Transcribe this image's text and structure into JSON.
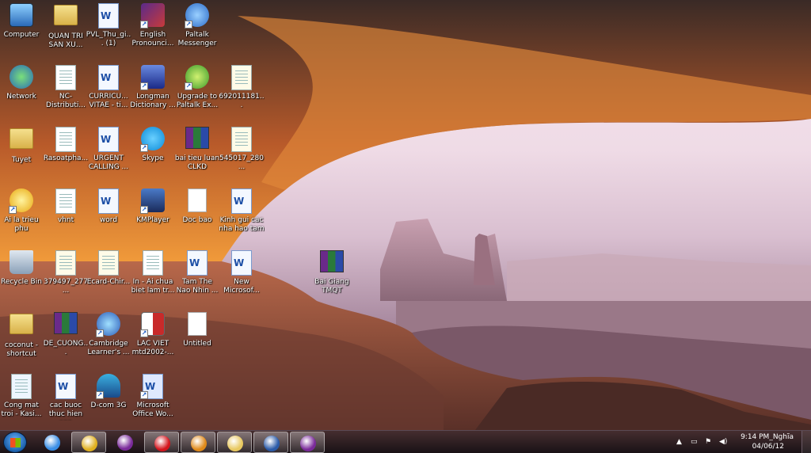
{
  "desktop": {
    "icons": [
      {
        "label": "Computer",
        "icon": "computer-icon"
      },
      {
        "label": "QUAN TRI SAN XU...",
        "icon": "folder-icon"
      },
      {
        "label": "PVL_Thu_gi... (1)",
        "icon": "word-document-icon"
      },
      {
        "label": "English Pronounci...",
        "icon": "epd-app-icon"
      },
      {
        "label": "Paltalk Messenger",
        "icon": "paltalk-icon"
      },
      {
        "label": "Network",
        "icon": "network-icon"
      },
      {
        "label": "NC-Distributi...",
        "icon": "document-icon"
      },
      {
        "label": "CURRICU... VITAE - ti...",
        "icon": "word-document-icon"
      },
      {
        "label": "Longman Dictionary ...",
        "icon": "longman-icon"
      },
      {
        "label": "Upgrade to Paltalk Ex...",
        "icon": "paltalk-upgrade-icon"
      },
      {
        "label": "692011181...",
        "icon": "image-file-icon"
      },
      {
        "label": "Tuyet",
        "icon": "folder-icon"
      },
      {
        "label": "Rasoatpha...",
        "icon": "document-icon"
      },
      {
        "label": "URGENT CALLING ...",
        "icon": "word-document-icon"
      },
      {
        "label": "Skype",
        "icon": "skype-icon"
      },
      {
        "label": "bai tieu luan CLKD",
        "icon": "winrar-archive-icon"
      },
      {
        "label": "545017_280...",
        "icon": "image-file-icon"
      },
      {
        "label": "Ai la trieu phu",
        "icon": "star-game-icon"
      },
      {
        "label": "vhnt",
        "icon": "document-icon"
      },
      {
        "label": "word",
        "icon": "word-document-icon"
      },
      {
        "label": "KMPlayer",
        "icon": "kmplayer-icon"
      },
      {
        "label": "Doc bao",
        "icon": "blank-file-icon"
      },
      {
        "label": "Kinh gui cac nha hao tam",
        "icon": "word-document-icon"
      },
      {
        "label": "Recycle Bin",
        "icon": "recycle-bin-icon"
      },
      {
        "label": "379497_277...",
        "icon": "image-file-icon"
      },
      {
        "label": "Ecard-Chir...",
        "icon": "image-file-icon"
      },
      {
        "label": "In - Ai chua biet lam tr...",
        "icon": "document-icon"
      },
      {
        "label": "Tam The Nao Nhin ...",
        "icon": "word-document-icon"
      },
      {
        "label": "New Microsof...",
        "icon": "word-document-icon"
      },
      {
        "label": "Bai Giang TMQT",
        "icon": "winrar-archive-icon"
      },
      {
        "label": "coconut - shortcut",
        "icon": "folder-icon"
      },
      {
        "label": "DE_CUONG...",
        "icon": "winrar-archive-icon"
      },
      {
        "label": "Cambridge Learner's ...",
        "icon": "cambridge-icon"
      },
      {
        "label": "LAC VIET mtd2002-...",
        "icon": "lacviet-icon"
      },
      {
        "label": "Untitled",
        "icon": "blank-file-icon"
      },
      {
        "label": "Cong mat troi - Kasi...",
        "icon": "mp3-file-icon"
      },
      {
        "label": "cac buoc thuc hien seo",
        "icon": "word-document-icon"
      },
      {
        "label": "D-com 3G",
        "icon": "dcom-icon"
      },
      {
        "label": "Microsoft Office Wo...",
        "icon": "word-application-icon"
      }
    ]
  },
  "taskbar": {
    "start_icon": "windows-start-icon",
    "pinned": [
      {
        "name": "internet-explorer-icon",
        "color": "#3a8ee6",
        "active": false
      },
      {
        "name": "chrome-icon",
        "color": "#e0b020",
        "active": true
      },
      {
        "name": "yahoo-messenger-icon",
        "color": "#7a2a9a",
        "active": false
      },
      {
        "name": "opera-icon",
        "color": "#d4141c",
        "active": true
      },
      {
        "name": "media-player-icon",
        "color": "#e08a1a",
        "active": true
      },
      {
        "name": "windows-explorer-icon",
        "color": "#e8c860",
        "active": true
      },
      {
        "name": "word-icon",
        "color": "#2a5aa8",
        "active": true
      },
      {
        "name": "yahoo-messenger-chat-icon",
        "color": "#7a2a9a",
        "active": true
      }
    ],
    "tray": {
      "time": "9:14 PM_Nghĩa",
      "date": "04/06/12"
    }
  }
}
